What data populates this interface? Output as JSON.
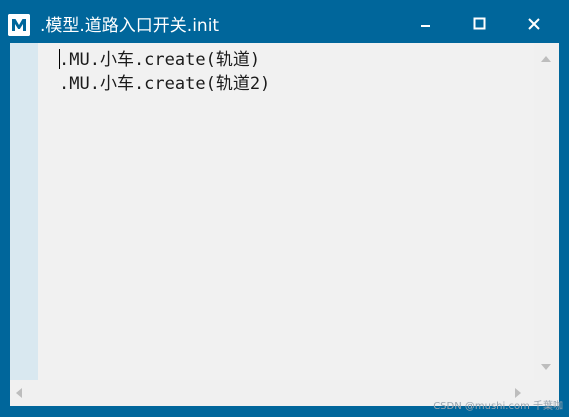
{
  "window": {
    "title": ".模型.道路入口开关.init",
    "app_icon_letter": "M"
  },
  "editor": {
    "lines": [
      ".MU.小车.create(轨道)",
      ".MU.小车.create(轨道2)"
    ]
  },
  "icons": {
    "app": "app-logo-icon",
    "minimize": "minimize-icon",
    "maximize": "maximize-icon",
    "close": "close-icon"
  },
  "colors": {
    "titlebar": "#00669b",
    "gutter": "#d9e8f0",
    "editor_bg": "#f1f1f1"
  },
  "watermark": "CSDN @mushi.com 千葉咖"
}
